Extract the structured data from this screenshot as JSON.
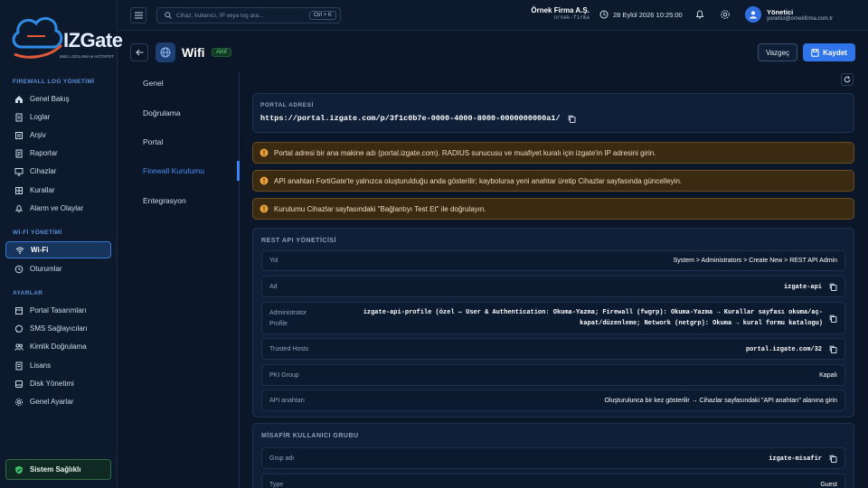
{
  "brand": {
    "logo_text": "IZGate",
    "tagline": "5651 LOGLAMA & HOTSPOT"
  },
  "sidebar": {
    "sections": [
      {
        "title": "FIREWALL LOG YÖNETİMİ",
        "items": [
          {
            "label": "Genel Bakış",
            "icon": "home-icon"
          },
          {
            "label": "Loglar",
            "icon": "document-icon"
          },
          {
            "label": "Arşiv",
            "icon": "archive-icon"
          },
          {
            "label": "Raporlar",
            "icon": "report-icon"
          },
          {
            "label": "Cihazlar",
            "icon": "monitor-icon"
          },
          {
            "label": "Kurallar",
            "icon": "grid-icon"
          },
          {
            "label": "Alarm ve Olaylar",
            "icon": "bell-icon"
          }
        ]
      },
      {
        "title": "Wİ-Fİ YÖNETİMİ",
        "items": [
          {
            "label": "Wi-Fi",
            "icon": "wifi-icon",
            "active": true
          },
          {
            "label": "Oturumlar",
            "icon": "clock-icon"
          }
        ]
      },
      {
        "title": "AYARLAR",
        "items": [
          {
            "label": "Portal Tasarımları",
            "icon": "layout-icon"
          },
          {
            "label": "SMS Sağlayıcıları",
            "icon": "chat-icon"
          },
          {
            "label": "Kimlik Doğrulama",
            "icon": "users-icon"
          },
          {
            "label": "Lisans",
            "icon": "license-icon"
          },
          {
            "label": "Disk Yönetimi",
            "icon": "disk-icon"
          },
          {
            "label": "Genel Ayarlar",
            "icon": "gear-icon"
          }
        ]
      }
    ],
    "health": "Sistem Sağlıklı"
  },
  "topbar": {
    "search_placeholder": "Cihaz, kullanıcı, IP veya log ara...",
    "search_shortcut": "Ctrl + K",
    "org_name": "Örnek Firma A.Ş.",
    "org_slug": "ornek-firma",
    "datetime": "28 Eylül 2026 10:25:00",
    "user_name": "Yönetici",
    "user_email": "yonetici@ornekfirma.com.tr"
  },
  "page": {
    "title": "Wifi",
    "status": "Aktif",
    "cancel_label": "Vazgeç",
    "save_label": "Kaydet"
  },
  "tabs": [
    "Genel",
    "Doğrulama",
    "Portal",
    "Firewall Kurulumu",
    "Entegrasyon"
  ],
  "active_tab": "Firewall Kurulumu",
  "portal": {
    "label": "PORTAL ADRESİ",
    "url": "https://portal.izgate.com/p/3f1c0b7e-0000-4000-8000-0000000000a1/"
  },
  "warnings": [
    "Portal adresi bir ana makine adı (portal.izgate.com). RADIUS sunucusu ve muafiyet kuralı için izgate'in IP adresini girin.",
    "API anahtarı FortiGate'te yalnızca oluşturulduğu anda gösterilir; kaybolursa yeni anahtar üretip Cihazlar sayfasında güncelleyin.",
    "Kurulumu Cihazlar sayfasındaki \"Bağlantıyı Test Et\" ile doğrulayın."
  ],
  "rest_api": {
    "title": "REST API YÖNETİCİSİ",
    "rows": [
      {
        "key": "Yol",
        "value": "System > Administrators > Create New > REST API Admin"
      },
      {
        "key": "Ad",
        "value": "izgate-api"
      },
      {
        "key": "Administrator Profile",
        "value": "izgate-api-profile (özel — User & Authentication: Okuma-Yazma; Firewall (fwgrp): Okuma-Yazma → Kurallar sayfası okuma/aç-kapat/düzenleme; Network (netgrp): Okuma → kural formu katalogu)"
      },
      {
        "key": "Trusted Hosts",
        "value": "portal.izgate.com/32"
      },
      {
        "key": "PKI Group",
        "value": "Kapalı"
      },
      {
        "key": "API anahtarı",
        "value": "Oluşturulunca bir kez gösterilir → Cihazlar sayfasındaki \"API anahtarı\" alanına girin"
      }
    ]
  },
  "guest_group": {
    "title": "MİSAFİR KULLANICI GRUBU",
    "rows": [
      {
        "key": "Grup adı",
        "value": "izgate-misafir"
      },
      {
        "key": "Type",
        "value": "Guest"
      }
    ]
  }
}
